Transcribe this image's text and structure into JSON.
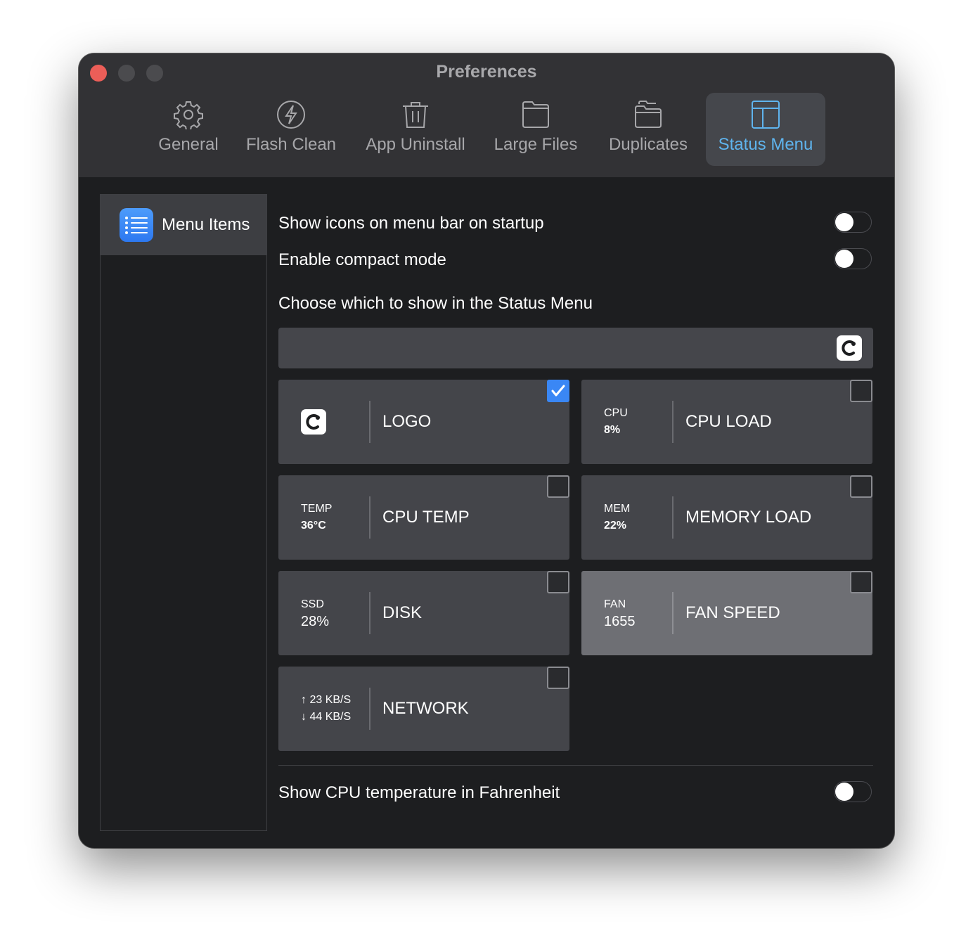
{
  "window": {
    "title": "Preferences"
  },
  "toolbar": {
    "tabs": [
      {
        "label": "General",
        "icon": "gear-icon"
      },
      {
        "label": "Flash Clean",
        "icon": "lightning-icon"
      },
      {
        "label": "App Uninstall",
        "icon": "trash-icon"
      },
      {
        "label": "Large Files",
        "icon": "folder-icon"
      },
      {
        "label": "Duplicates",
        "icon": "folders-icon"
      },
      {
        "label": "Status Menu",
        "icon": "layout-icon",
        "active": true
      }
    ]
  },
  "sidebar": {
    "items": [
      {
        "label": "Menu Items",
        "icon": "list-icon",
        "selected": true
      }
    ]
  },
  "settings": {
    "show_icons_startup": {
      "label": "Show icons on menu bar on startup",
      "on": false
    },
    "compact_mode": {
      "label": "Enable compact mode",
      "on": false
    },
    "choose_heading": "Choose which to show in the Status Menu",
    "fahrenheit": {
      "label": "Show CPU temperature in Fahrenheit",
      "on": false
    }
  },
  "items": [
    {
      "name": "LOGO",
      "checked": true
    },
    {
      "name": "CPU LOAD",
      "line1": "CPU",
      "line2": "8%",
      "checked": false
    },
    {
      "name": "CPU TEMP",
      "line1": "TEMP",
      "line2": "36°C",
      "checked": false
    },
    {
      "name": "MEMORY LOAD",
      "line1": "MEM",
      "line2": "22%",
      "checked": false
    },
    {
      "name": "DISK",
      "line1": "SSD",
      "line2": "28%",
      "checked": false
    },
    {
      "name": "FAN SPEED",
      "line1": "FAN",
      "line2": "1655",
      "checked": false
    },
    {
      "name": "NETWORK",
      "line1": "↑ 23 KB/S",
      "line2": "↓ 44 KB/S",
      "checked": false
    }
  ],
  "colors": {
    "accent": "#5fb4ee",
    "checkbox_on": "#3a87f5",
    "window_bg": "#1d1e20",
    "titlebar_bg": "#323235"
  }
}
